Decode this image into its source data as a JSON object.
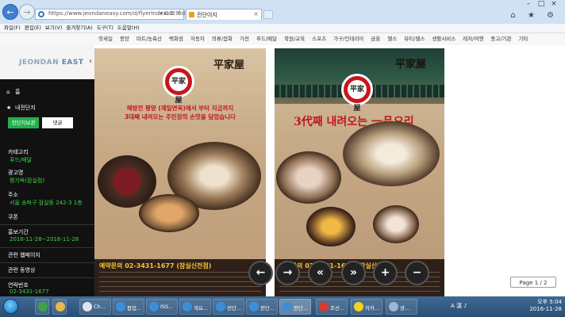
{
  "browser": {
    "url": "https://www.jeondaneasy.com/d/flyerIndex.do?fid=",
    "address_controls": "▾ ⊠ C ×",
    "tab_title": "전단이지",
    "tab_close": "×",
    "window_buttons": [
      "–",
      "□",
      "×"
    ],
    "toolbar_icons": "⌂ ★ ⚙"
  },
  "menubar": [
    "파일(F)",
    "편집(E)",
    "보기(V)",
    "즐겨찾기(A)",
    "도구(T)",
    "도움말(H)"
  ],
  "category_nav": [
    "핫세일",
    "봉양",
    "마트/농축산",
    "백화점",
    "자동차",
    "의류/잡화",
    "가전",
    "푸드/배달",
    "학원/교육",
    "스포츠",
    "가구/인테리어",
    "금융",
    "헬스",
    "뷰티/헬스",
    "생활서비스",
    "레저/여행",
    "중고/기관",
    "기타"
  ],
  "sidebar": {
    "logo_prefix": "JEONDAN ",
    "logo_suffix": "EAST",
    "collapse_icon": "‹",
    "home_icon": "⌂",
    "home_label": "홈",
    "fav_icon": "★",
    "fav_label": "내전단지",
    "btn_favorite": "전단지보관",
    "btn_comment": "댓글",
    "category_label": "카테고리",
    "category_value": "푸드/배달",
    "advertiser_label": "광고명",
    "advertiser_value": "평가옥(잠실점)",
    "address_label": "주소",
    "address_value": "서울 송파구 잠실동 242-3 1층",
    "coupon_label": "쿠폰",
    "period_label": "홍보기간",
    "period_value": "2016-11-28~2016-11-28",
    "homepage_label": "관련 웹페이지",
    "video_label": "관련 동영상",
    "contact_label": "연락번호",
    "contact_value": "02-3431-1677"
  },
  "flyer_left": {
    "brand_han": "平家屋",
    "emblem_text": "平家屋",
    "promo_line1": "해방전 평양 (제일면옥)에서 부터 지금까지",
    "promo_line2": "3대째 내려오는 주인장의 손맛을 담았습니다",
    "phone": "예약문의 02-3431-1677 (잠실신천점)"
  },
  "flyer_right": {
    "brand_han": "平家屋",
    "emblem_text": "平家屋",
    "slogan": "3代째 내려오는 一品요리",
    "phone": "예약문의 02-3431-1677 (잠실신천점)"
  },
  "viewer": {
    "prev_icon": "←",
    "next_icon": "→",
    "first_icon": "«",
    "last_icon": "»",
    "zoom_in_icon": "+",
    "zoom_out_icon": "−",
    "page_indicator": "Page 1 / 2"
  },
  "taskbar": {
    "items": [
      "Ch...",
      "팝업...",
      "ISS...",
      "게요...",
      "전단...",
      "전단...",
      "전단...",
      "조선...",
      "카카...",
      "광..."
    ],
    "ime": "A 漢 ♪",
    "time": "오후 5:04",
    "date": "2016-11-28"
  },
  "colors": {
    "accent_green": "#3fd14a",
    "button_green": "#22b14c",
    "promo_red": "#c0141b",
    "phone_gold": "#f6c23a"
  }
}
